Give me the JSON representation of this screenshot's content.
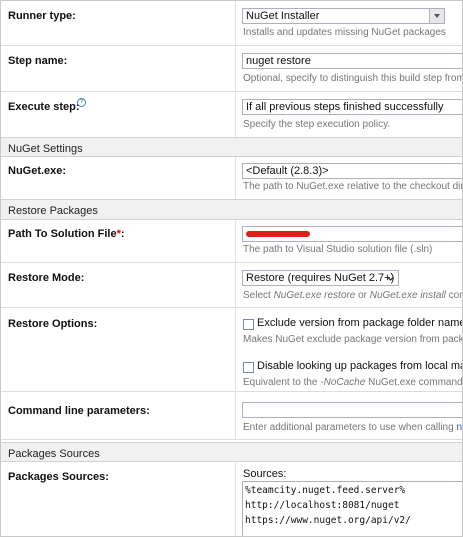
{
  "runner_type": {
    "label": "Runner type:",
    "value": "NuGet Installer",
    "hint": "Installs and updates missing NuGet packages"
  },
  "step_name": {
    "label": "Step name:",
    "value": "nuget restore",
    "hint": "Optional, specify to distinguish this build step from"
  },
  "execute_step": {
    "label": "Execute step:",
    "value": "If all previous steps finished successfully",
    "hint": "Specify the step execution policy."
  },
  "nuget_settings": {
    "title": "NuGet Settings",
    "nuget_exe": {
      "label": "NuGet.exe:",
      "value": "<Default (2.8.3)>",
      "hint": "The path to NuGet.exe relative to the checkout direc"
    }
  },
  "restore_packages": {
    "title": "Restore Packages",
    "solution": {
      "label": "Path To Solution File",
      "required_mark": "*",
      "label_suffix": ":",
      "hint": "The path to Visual Studio solution file (.sln)"
    },
    "restore_mode": {
      "label": "Restore Mode:",
      "value": "Restore (requires NuGet 2.7+)",
      "hint_a": "Select ",
      "hint_b": "NuGet.exe restore",
      "hint_c": " or ",
      "hint_d": "NuGet.exe install",
      "hint_e": " comm"
    },
    "restore_options": {
      "label": "Restore Options:",
      "opt1_label": "Exclude version from package folder names",
      "opt1_checked": false,
      "opt1_hint": "Makes NuGet exclude package version from package",
      "opt2_label": "Disable looking up packages from local mach",
      "opt2_checked": false,
      "opt2_hint_a": "Equivalent to the ",
      "opt2_hint_b": "-NoCache",
      "opt2_hint_c": " NuGet.exe commandline"
    },
    "command_line": {
      "label": "Command line parameters:",
      "value": "",
      "hint_a": "Enter additional parameters to use when calling ",
      "hint_b": "nu"
    }
  },
  "packages_sources": {
    "title": "Packages Sources",
    "label": "Packages Sources:",
    "sources_label": "Sources:",
    "sources": [
      "%teamcity.nuget.feed.server%",
      "http://localhost:8081/nuget",
      "https://www.nuget.org/api/v2/"
    ]
  },
  "colors": {
    "section_bg": "#f1f1f1",
    "link": "#1a5fb4",
    "required": "#dd0000",
    "redaction": "#e0201c"
  }
}
